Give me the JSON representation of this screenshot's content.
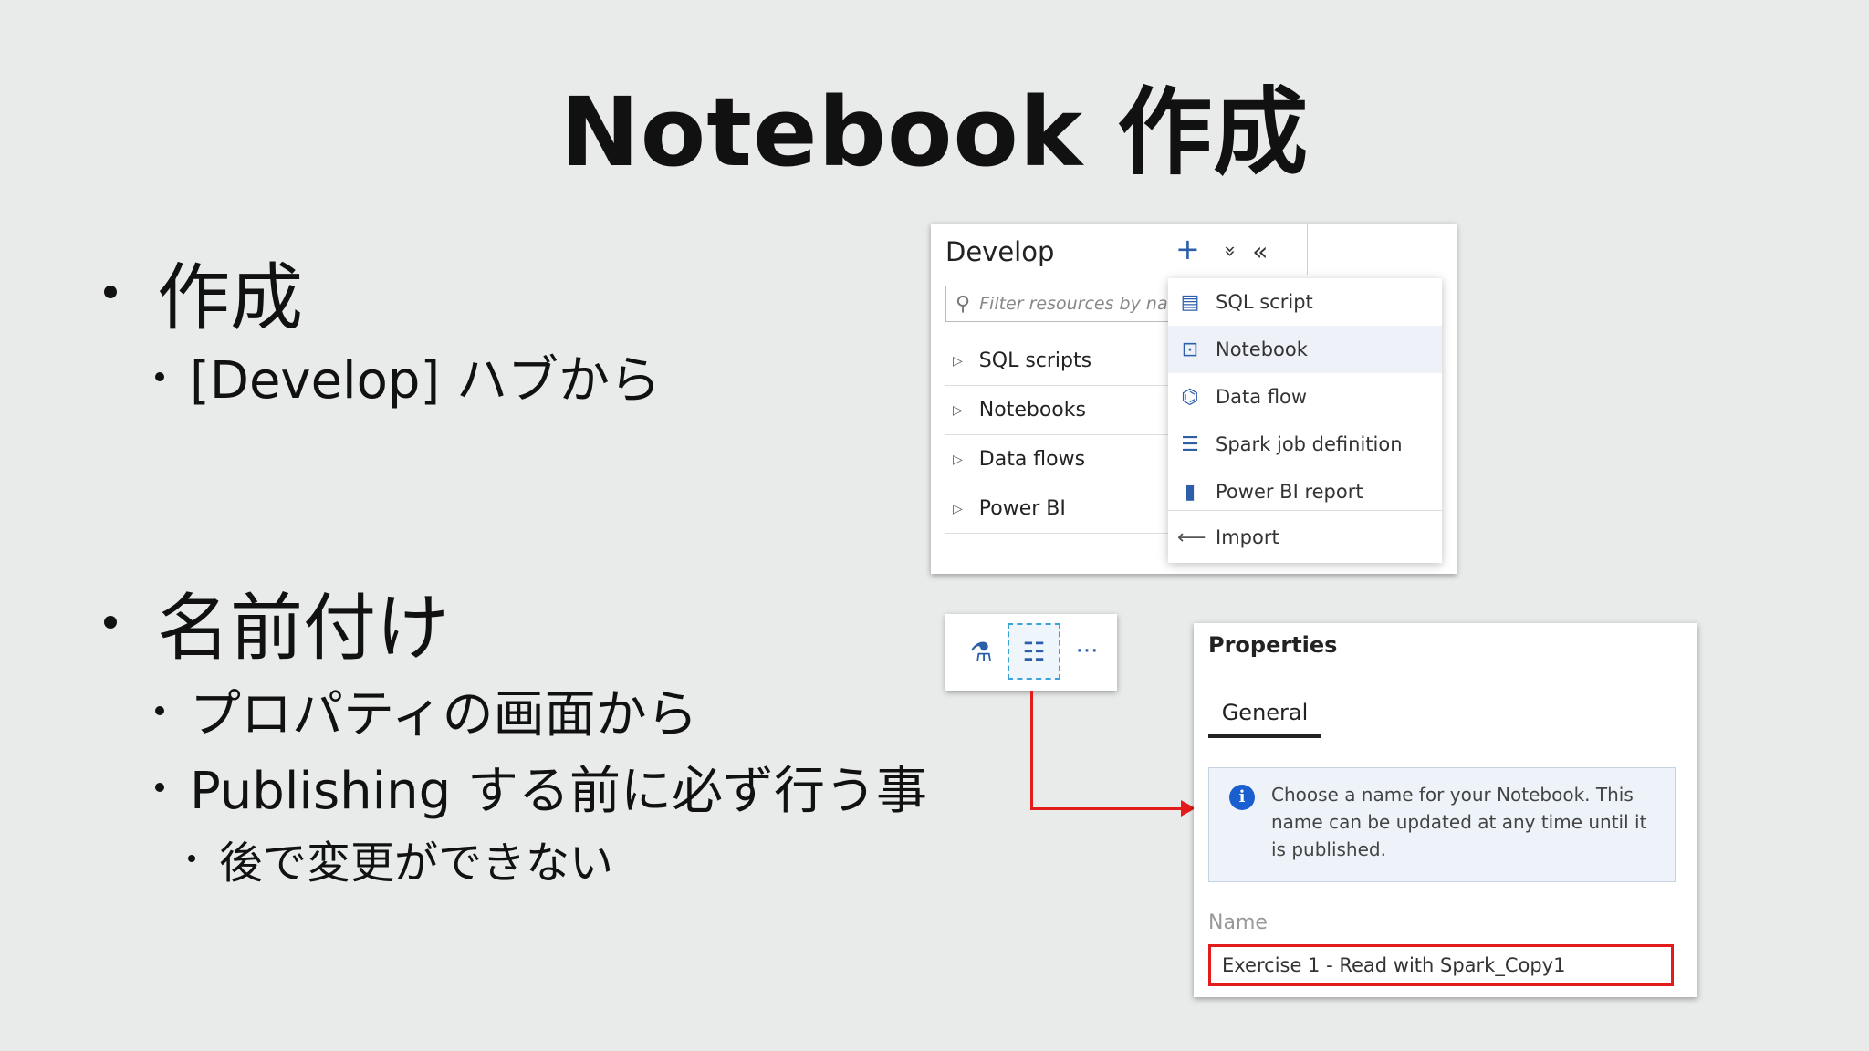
{
  "slide": {
    "title": "Notebook 作成",
    "bullets": {
      "create": "作成",
      "create_sub": "[Develop] ハブから",
      "naming": "名前付け",
      "naming_sub1": "プロパティの画面から",
      "naming_sub2": "Publishing する前に必ず行う事",
      "naming_sub3": "後で変更ができない"
    }
  },
  "develop": {
    "title": "Develop",
    "actions": {
      "add": "+",
      "expand": "»",
      "collapse": "«"
    },
    "filter_placeholder": "Filter resources by name",
    "tree": [
      "SQL scripts",
      "Notebooks",
      "Data flows",
      "Power BI"
    ],
    "menu": {
      "items": [
        "SQL script",
        "Notebook",
        "Data flow",
        "Spark job definition",
        "Power BI report"
      ],
      "import": "Import",
      "selected": "Notebook"
    }
  },
  "toolbar": {
    "more": "···"
  },
  "properties": {
    "title": "Properties",
    "tab": "General",
    "info": "Choose a name for your Notebook. This name can be updated at any time until it is published.",
    "name_label": "Name",
    "name_value": "Exercise 1 - Read with Spark_Copy1"
  },
  "colors": {
    "accent_red": "#e21b1b",
    "info_blue": "#1a5fd0",
    "icon_blue": "#2c5fa8"
  }
}
